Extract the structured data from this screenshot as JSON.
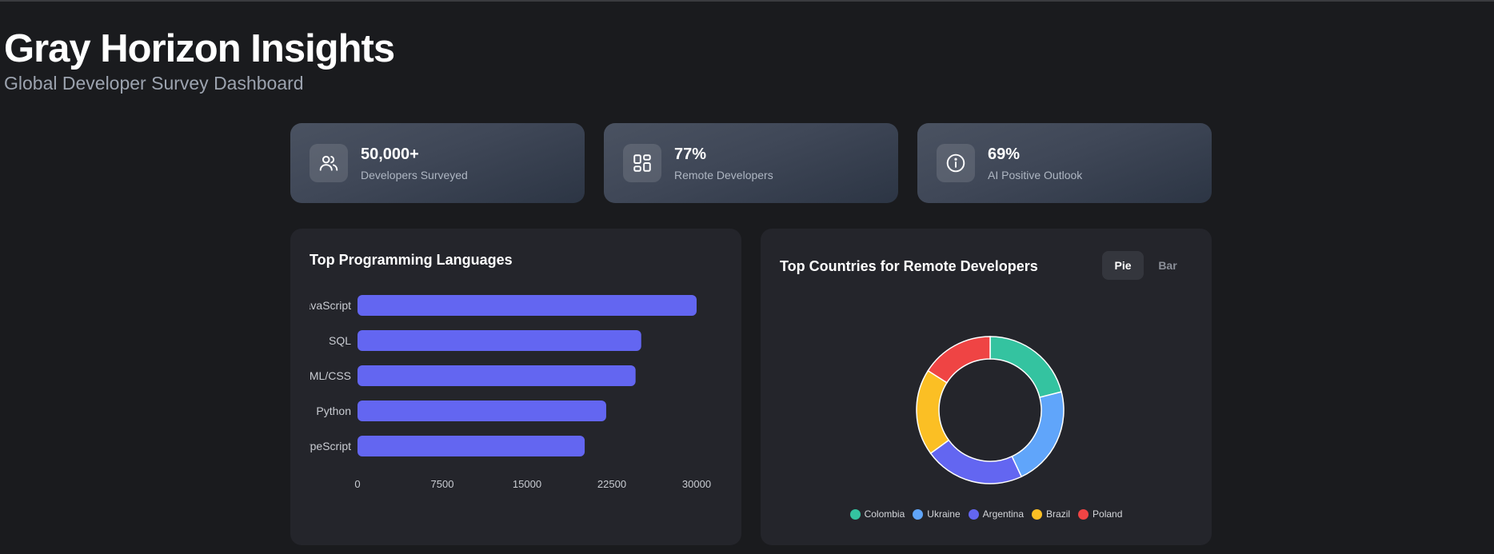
{
  "header": {
    "title": "Gray Horizon Insights",
    "subtitle": "Global Developer Survey Dashboard"
  },
  "stats": [
    {
      "value": "50,000+",
      "label": "Developers Surveyed",
      "icon": "users-icon"
    },
    {
      "value": "77%",
      "label": "Remote Developers",
      "icon": "dashboard-icon"
    },
    {
      "value": "69%",
      "label": "AI Positive Outlook",
      "icon": "info-icon"
    }
  ],
  "languages_panel": {
    "title": "Top Programming Languages"
  },
  "countries_panel": {
    "title": "Top Countries for Remote Developers",
    "toggle_pie": "Pie",
    "toggle_bar": "Bar",
    "active_view": "Pie"
  },
  "chart_data": [
    {
      "type": "bar",
      "orientation": "horizontal",
      "title": "Top Programming Languages",
      "categories": [
        "JavaScript",
        "SQL",
        "HTML/CSS",
        "Python",
        "TypeScript"
      ],
      "values": [
        30000,
        25100,
        24600,
        22000,
        20100
      ],
      "xlim": [
        0,
        30000
      ],
      "xticks": [
        0,
        7500,
        15000,
        22500,
        30000
      ],
      "color": "#6366f1",
      "grid": false
    },
    {
      "type": "pie",
      "style": "donut",
      "title": "Top Countries for Remote Developers",
      "categories": [
        "Colombia",
        "Ukraine",
        "Argentina",
        "Brazil",
        "Poland"
      ],
      "values": [
        21,
        22,
        22,
        19,
        16
      ],
      "colors": [
        "#34c3a0",
        "#60a5fa",
        "#6366f1",
        "#fbbf24",
        "#ef4444"
      ],
      "legend": "bottom"
    }
  ]
}
